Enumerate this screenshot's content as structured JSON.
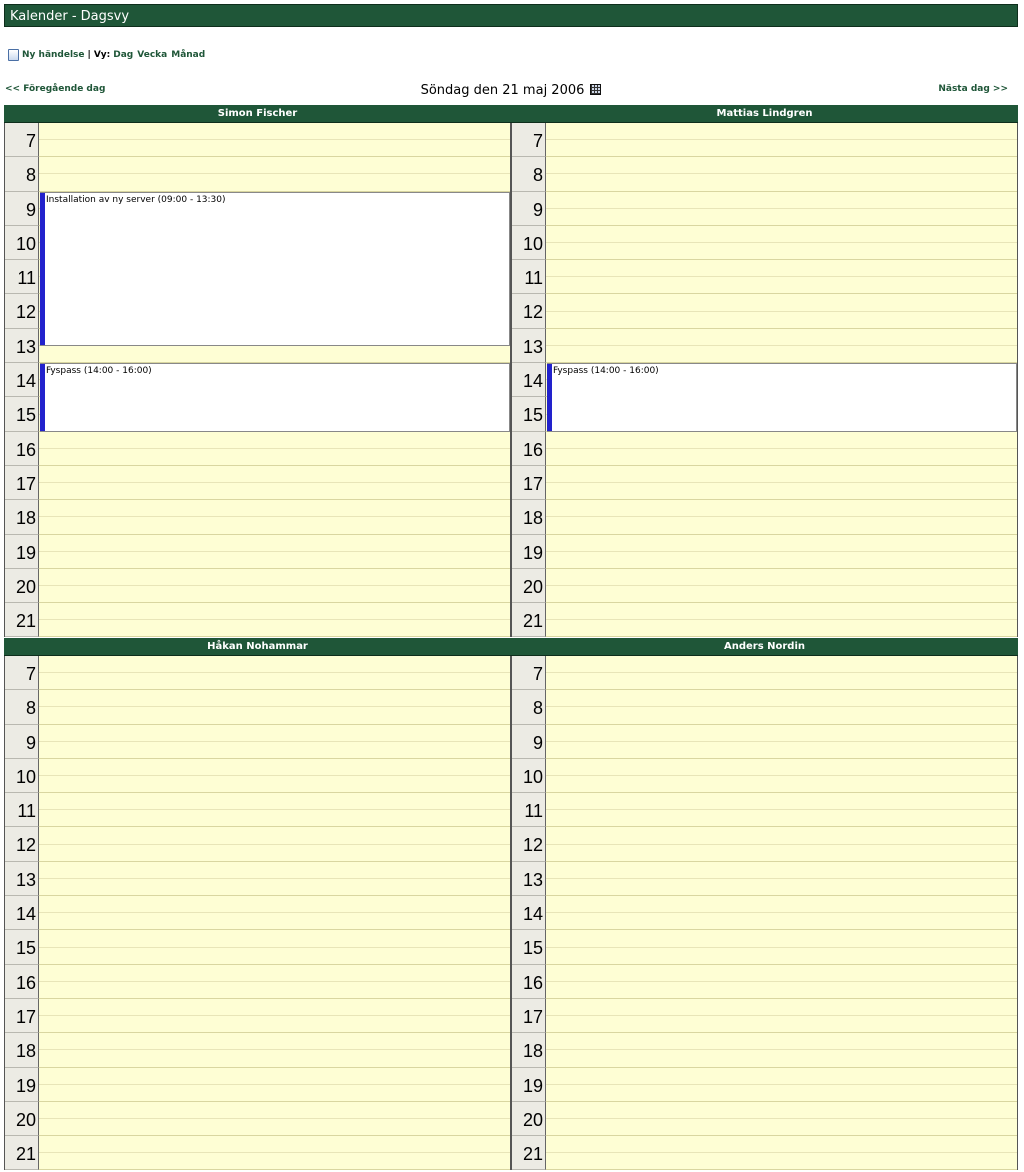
{
  "app": {
    "title": "Kalender - Dagsvy"
  },
  "toolbar": {
    "new_event_label": "Ny händelse",
    "separator": "|",
    "view_label": "Vy:",
    "views": [
      "Dag",
      "Vecka",
      "Månad"
    ]
  },
  "nav": {
    "prev_label": "<< Föregående dag",
    "next_label": "Nästa dag >>",
    "date_title": "Söndag den 21 maj 2006"
  },
  "colors": {
    "header": "#1f5638",
    "slot_bg": "#fefed4",
    "event_bar": "#2222cc"
  },
  "hours": [
    "7",
    "8",
    "9",
    "10",
    "11",
    "12",
    "13",
    "14",
    "15",
    "16",
    "17",
    "18",
    "19",
    "20",
    "21"
  ],
  "people": [
    {
      "name": "Simon Fischer",
      "events": [
        {
          "title": "Installation av ny server (09:00 - 13:30)",
          "start_hour": 9.0,
          "end_hour": 13.5
        },
        {
          "title": "Fyspass (14:00 - 16:00)",
          "start_hour": 14.0,
          "end_hour": 16.0
        }
      ]
    },
    {
      "name": "Mattias Lindgren",
      "events": [
        {
          "title": "Fyspass (14:00 - 16:00)",
          "start_hour": 14.0,
          "end_hour": 16.0
        }
      ]
    },
    {
      "name": "Håkan Nohammar",
      "events": []
    },
    {
      "name": "Anders Nordin",
      "events": []
    }
  ]
}
